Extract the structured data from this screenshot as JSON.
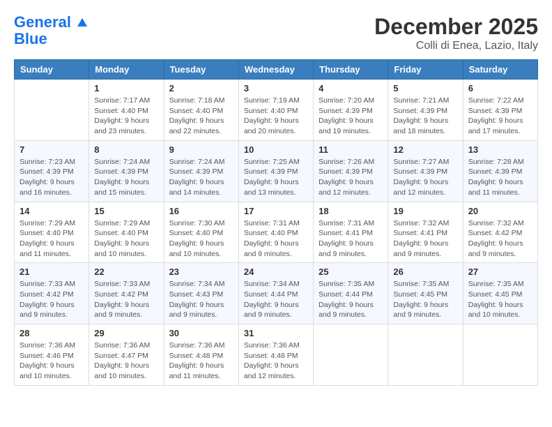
{
  "header": {
    "logo_line1": "General",
    "logo_line2": "Blue",
    "month": "December 2025",
    "location": "Colli di Enea, Lazio, Italy"
  },
  "days_of_week": [
    "Sunday",
    "Monday",
    "Tuesday",
    "Wednesday",
    "Thursday",
    "Friday",
    "Saturday"
  ],
  "weeks": [
    [
      {
        "day": "",
        "info": ""
      },
      {
        "day": "1",
        "info": "Sunrise: 7:17 AM\nSunset: 4:40 PM\nDaylight: 9 hours\nand 23 minutes."
      },
      {
        "day": "2",
        "info": "Sunrise: 7:18 AM\nSunset: 4:40 PM\nDaylight: 9 hours\nand 22 minutes."
      },
      {
        "day": "3",
        "info": "Sunrise: 7:19 AM\nSunset: 4:40 PM\nDaylight: 9 hours\nand 20 minutes."
      },
      {
        "day": "4",
        "info": "Sunrise: 7:20 AM\nSunset: 4:39 PM\nDaylight: 9 hours\nand 19 minutes."
      },
      {
        "day": "5",
        "info": "Sunrise: 7:21 AM\nSunset: 4:39 PM\nDaylight: 9 hours\nand 18 minutes."
      },
      {
        "day": "6",
        "info": "Sunrise: 7:22 AM\nSunset: 4:39 PM\nDaylight: 9 hours\nand 17 minutes."
      }
    ],
    [
      {
        "day": "7",
        "info": "Sunrise: 7:23 AM\nSunset: 4:39 PM\nDaylight: 9 hours\nand 16 minutes."
      },
      {
        "day": "8",
        "info": "Sunrise: 7:24 AM\nSunset: 4:39 PM\nDaylight: 9 hours\nand 15 minutes."
      },
      {
        "day": "9",
        "info": "Sunrise: 7:24 AM\nSunset: 4:39 PM\nDaylight: 9 hours\nand 14 minutes."
      },
      {
        "day": "10",
        "info": "Sunrise: 7:25 AM\nSunset: 4:39 PM\nDaylight: 9 hours\nand 13 minutes."
      },
      {
        "day": "11",
        "info": "Sunrise: 7:26 AM\nSunset: 4:39 PM\nDaylight: 9 hours\nand 12 minutes."
      },
      {
        "day": "12",
        "info": "Sunrise: 7:27 AM\nSunset: 4:39 PM\nDaylight: 9 hours\nand 12 minutes."
      },
      {
        "day": "13",
        "info": "Sunrise: 7:28 AM\nSunset: 4:39 PM\nDaylight: 9 hours\nand 11 minutes."
      }
    ],
    [
      {
        "day": "14",
        "info": "Sunrise: 7:29 AM\nSunset: 4:40 PM\nDaylight: 9 hours\nand 11 minutes."
      },
      {
        "day": "15",
        "info": "Sunrise: 7:29 AM\nSunset: 4:40 PM\nDaylight: 9 hours\nand 10 minutes."
      },
      {
        "day": "16",
        "info": "Sunrise: 7:30 AM\nSunset: 4:40 PM\nDaylight: 9 hours\nand 10 minutes."
      },
      {
        "day": "17",
        "info": "Sunrise: 7:31 AM\nSunset: 4:40 PM\nDaylight: 9 hours\nand 9 minutes."
      },
      {
        "day": "18",
        "info": "Sunrise: 7:31 AM\nSunset: 4:41 PM\nDaylight: 9 hours\nand 9 minutes."
      },
      {
        "day": "19",
        "info": "Sunrise: 7:32 AM\nSunset: 4:41 PM\nDaylight: 9 hours\nand 9 minutes."
      },
      {
        "day": "20",
        "info": "Sunrise: 7:32 AM\nSunset: 4:42 PM\nDaylight: 9 hours\nand 9 minutes."
      }
    ],
    [
      {
        "day": "21",
        "info": "Sunrise: 7:33 AM\nSunset: 4:42 PM\nDaylight: 9 hours\nand 9 minutes."
      },
      {
        "day": "22",
        "info": "Sunrise: 7:33 AM\nSunset: 4:42 PM\nDaylight: 9 hours\nand 9 minutes."
      },
      {
        "day": "23",
        "info": "Sunrise: 7:34 AM\nSunset: 4:43 PM\nDaylight: 9 hours\nand 9 minutes."
      },
      {
        "day": "24",
        "info": "Sunrise: 7:34 AM\nSunset: 4:44 PM\nDaylight: 9 hours\nand 9 minutes."
      },
      {
        "day": "25",
        "info": "Sunrise: 7:35 AM\nSunset: 4:44 PM\nDaylight: 9 hours\nand 9 minutes."
      },
      {
        "day": "26",
        "info": "Sunrise: 7:35 AM\nSunset: 4:45 PM\nDaylight: 9 hours\nand 9 minutes."
      },
      {
        "day": "27",
        "info": "Sunrise: 7:35 AM\nSunset: 4:45 PM\nDaylight: 9 hours\nand 10 minutes."
      }
    ],
    [
      {
        "day": "28",
        "info": "Sunrise: 7:36 AM\nSunset: 4:46 PM\nDaylight: 9 hours\nand 10 minutes."
      },
      {
        "day": "29",
        "info": "Sunrise: 7:36 AM\nSunset: 4:47 PM\nDaylight: 9 hours\nand 10 minutes."
      },
      {
        "day": "30",
        "info": "Sunrise: 7:36 AM\nSunset: 4:48 PM\nDaylight: 9 hours\nand 11 minutes."
      },
      {
        "day": "31",
        "info": "Sunrise: 7:36 AM\nSunset: 4:48 PM\nDaylight: 9 hours\nand 12 minutes."
      },
      {
        "day": "",
        "info": ""
      },
      {
        "day": "",
        "info": ""
      },
      {
        "day": "",
        "info": ""
      }
    ]
  ]
}
